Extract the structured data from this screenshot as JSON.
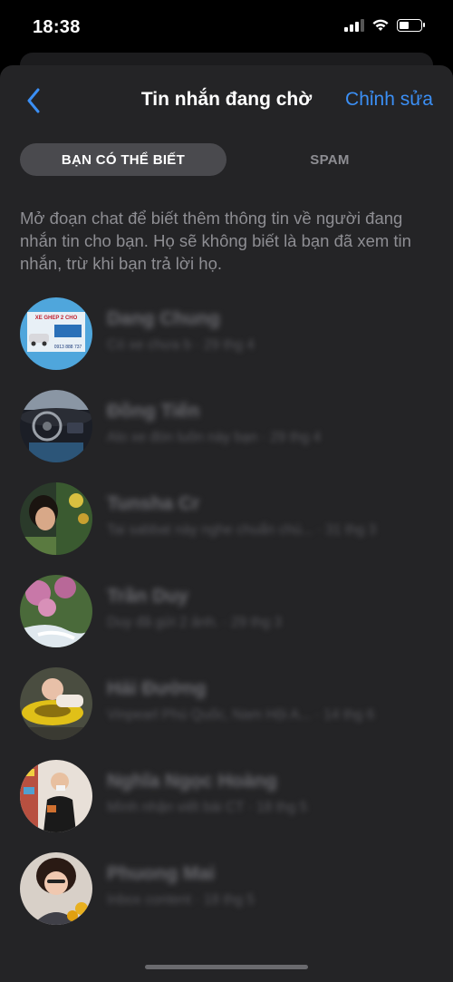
{
  "status_bar": {
    "time": "18:38"
  },
  "nav": {
    "title": "Tin nhắn đang chờ",
    "edit_label": "Chỉnh sửa"
  },
  "tabs": [
    {
      "label": "BẠN CÓ THỂ BIẾT",
      "active": true
    },
    {
      "label": "SPAM",
      "active": false
    }
  ],
  "description": "Mở đoạn chat để biết thêm thông tin về người đang nhắn tin cho bạn. Họ sẽ không biết là bạn đã xem tin nhắn, trừ khi bạn trả lời họ.",
  "avatar_text": {
    "line1": "XE GHEP 2 CHO",
    "line2": "0913 888 737"
  },
  "messages": [
    {
      "name": "Dang Chung",
      "preview": "Có xe chưa b · 29 thg 4"
    },
    {
      "name": "Đồng Tiến",
      "preview": "Alo xe đón luôn này bạn · 29 thg 4"
    },
    {
      "name": "Tunsha Cr",
      "preview": "Tai sabbat này nghe chuẩn chú... · 31 thg 3"
    },
    {
      "name": "Trần Duy",
      "preview": "Duy đã gửi 2 ảnh. · 29 thg 3"
    },
    {
      "name": "Hải Đường",
      "preview": "Vinpearl Phú Quốc, Nam Hội A... · 14 thg 6"
    },
    {
      "name": "Nghĩa Ngọc Hoàng",
      "preview": "Mình nhận viết bài CT · 18 thg 5"
    },
    {
      "name": "Phuong Mai",
      "preview": "Inbox content · 18 thg 5"
    }
  ],
  "colors": {
    "accent": "#3b8ff5",
    "sheet": "#242426",
    "segment_active": "#4a4a4e"
  },
  "icons": {
    "back": "chevron-left-icon",
    "wifi": "wifi-icon",
    "signal": "signal-icon",
    "battery": "battery-icon"
  }
}
